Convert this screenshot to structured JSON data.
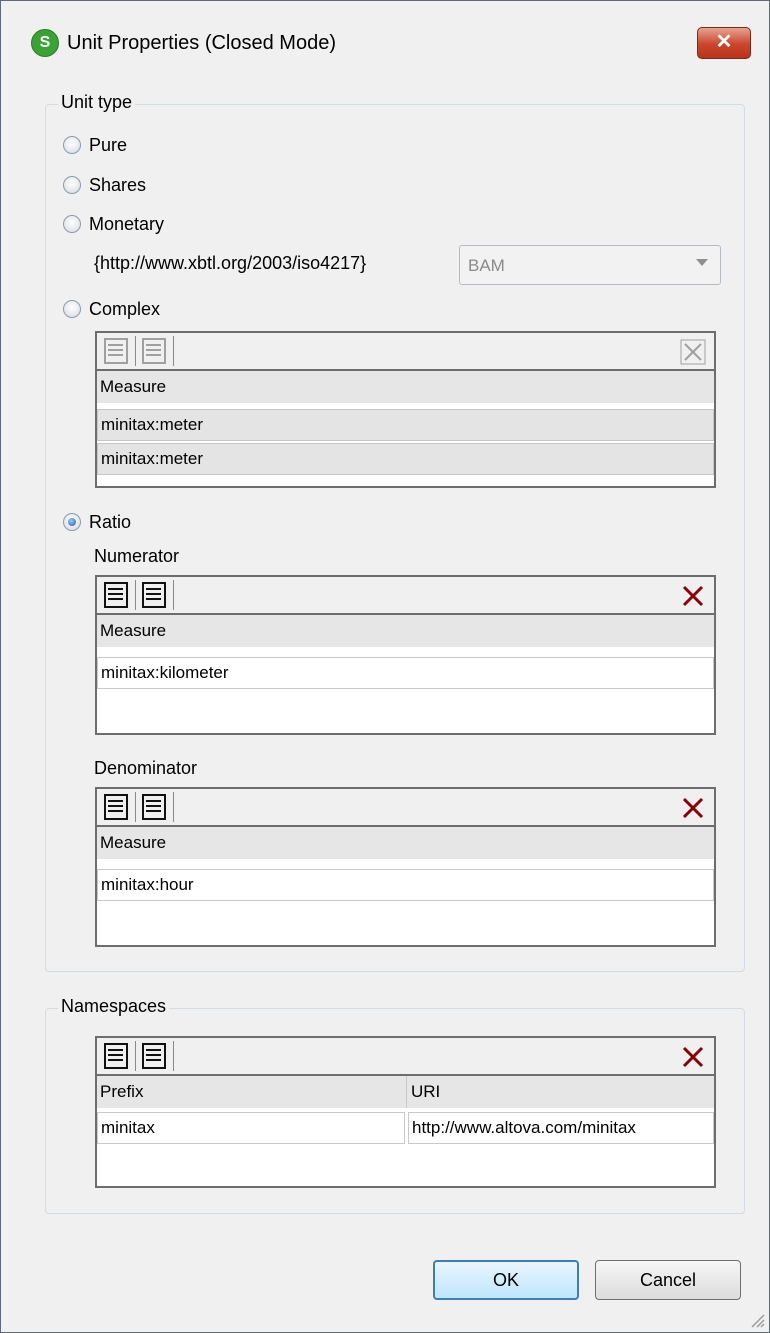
{
  "window": {
    "title": "Unit Properties (Closed Mode)",
    "app_icon_glyph": "S",
    "close_glyph": "✕"
  },
  "unit_type": {
    "legend": "Unit type",
    "pure_label": "Pure",
    "shares_label": "Shares",
    "monetary_label": "Monetary",
    "monetary_namespace": "{http://www.xbtl.org/2003/iso4217}",
    "currency_value": "BAM",
    "complex_label": "Complex",
    "complex_grid": {
      "header": "Measure",
      "rows": [
        "minitax:meter",
        "minitax:meter"
      ]
    },
    "ratio_label": "Ratio",
    "selected": "Ratio",
    "numerator": {
      "label": "Numerator",
      "header": "Measure",
      "rows": [
        "minitax:kilometer"
      ]
    },
    "denominator": {
      "label": "Denominator",
      "header": "Measure",
      "rows": [
        "minitax:hour"
      ]
    }
  },
  "namespaces": {
    "legend": "Namespaces",
    "headers": {
      "prefix": "Prefix",
      "uri": "URI"
    },
    "rows": [
      {
        "prefix": "minitax",
        "uri": "http://www.altova.com/minitax"
      }
    ]
  },
  "buttons": {
    "ok": "OK",
    "cancel": "Cancel"
  },
  "colors": {
    "delete_icon": "#8b0000",
    "default_button_border": "#3c7fb1",
    "app_icon": "#3ba236"
  }
}
